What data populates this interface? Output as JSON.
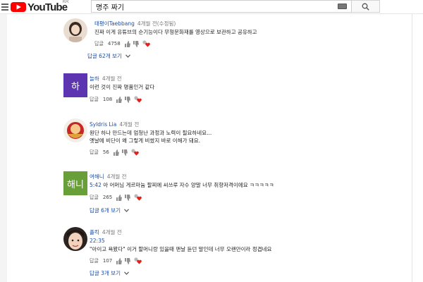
{
  "header": {
    "logo_text": "YouTube",
    "region": "KR",
    "search_value": "명주 짜기"
  },
  "comments": [
    {
      "author": "태평이Taebbang",
      "time": "4개월 전(수정됨)",
      "text_lines": [
        "진짜 이게 유튜브의 순기능이다 무형문화재를 영상으로 보관하고 공유하고"
      ],
      "reply_label": "답글",
      "likes": "4758",
      "replies": "답글 62개 보기"
    },
    {
      "author": "늘하",
      "time": "4개월 전",
      "avatar_letter": "하",
      "avatar_color": "#5e35b1",
      "text_lines": [
        "이런 것이 진짜 명품인거 같다"
      ],
      "reply_label": "답글",
      "likes": "108"
    },
    {
      "author": "Syldris Lia",
      "time": "4개월 전",
      "text_lines": [
        "원단 하나 만드는데 엄청난 과정과 노력이 필요하네요...",
        "옛날에 비단이 왜 그렇게 비쌌지 바로 이해가 돼요."
      ],
      "reply_label": "답글",
      "likes": "56"
    },
    {
      "author": "여해니",
      "time": "4개월 전",
      "avatar_letter": "해니",
      "avatar_color": "#689f38",
      "timestamp": "5:42",
      "text_lines": [
        " 아 어머님 게르마늄 팔찌에 씨쓰루 자수 양말 너무 취향저격이에요 ㅋㅋㅋㅋㅋ"
      ],
      "reply_label": "답글",
      "likes": "265",
      "replies": "답글 6개 보기"
    },
    {
      "author": "플킥",
      "time": "4개월 전",
      "timestamp": "22:35",
      "text_lines": [
        "\"아이고 욕봤다\" 이거 할머니랑 있을때 맨날 듣던 말인데 너무 오랜만이라 정겹네요"
      ],
      "reply_label": "답글",
      "likes": "107",
      "replies": "답글 3개 보기"
    }
  ],
  "colors": {
    "youtube_red": "#ff0000",
    "link_blue": "#1d4fa5",
    "heart_red": "#e0211c"
  }
}
